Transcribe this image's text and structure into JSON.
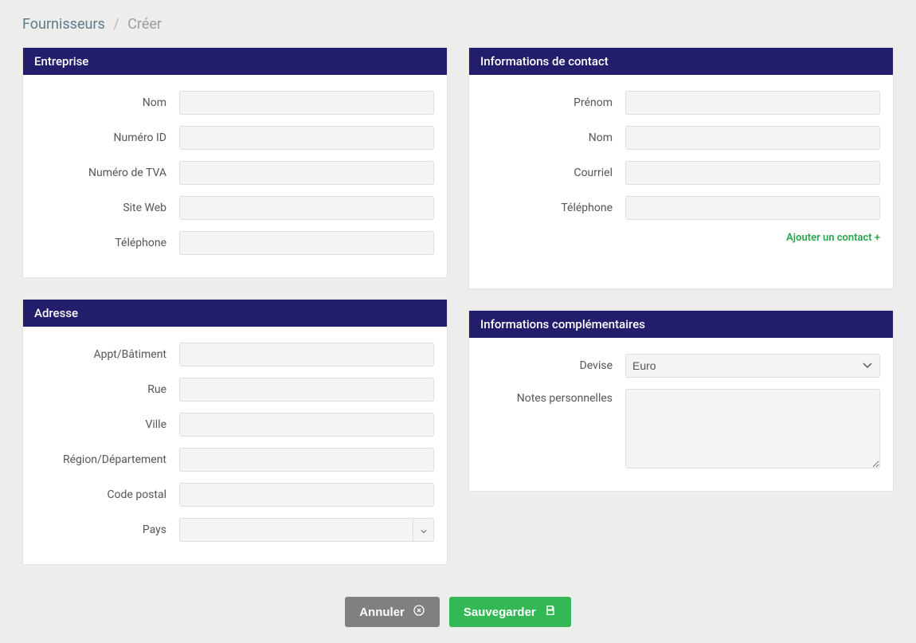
{
  "breadcrumb": {
    "parent": "Fournisseurs",
    "current": "Créer"
  },
  "panels": {
    "company": {
      "title": "Entreprise",
      "fields": {
        "name_label": "Nom",
        "id_label": "Numéro ID",
        "vat_label": "Numéro de TVA",
        "website_label": "Site Web",
        "phone_label": "Téléphone"
      },
      "values": {
        "name": "",
        "id": "",
        "vat": "",
        "website": "",
        "phone": ""
      }
    },
    "contact": {
      "title": "Informations de contact",
      "fields": {
        "firstname_label": "Prénom",
        "lastname_label": "Nom",
        "email_label": "Courriel",
        "phone_label": "Téléphone"
      },
      "values": {
        "firstname": "",
        "lastname": "",
        "email": "",
        "phone": ""
      },
      "add_link": "Ajouter un contact +"
    },
    "address": {
      "title": "Adresse",
      "fields": {
        "apt_label": "Appt/Bâtiment",
        "street_label": "Rue",
        "city_label": "Ville",
        "region_label": "Région/Département",
        "postal_label": "Code postal",
        "country_label": "Pays"
      },
      "values": {
        "apt": "",
        "street": "",
        "city": "",
        "region": "",
        "postal": "",
        "country": ""
      }
    },
    "extra": {
      "title": "Informations complémentaires",
      "fields": {
        "currency_label": "Devise",
        "notes_label": "Notes personnelles"
      },
      "values": {
        "currency": "Euro",
        "notes": ""
      },
      "currency_options": [
        "Euro"
      ]
    }
  },
  "actions": {
    "cancel": "Annuler",
    "save": "Sauvegarder"
  }
}
